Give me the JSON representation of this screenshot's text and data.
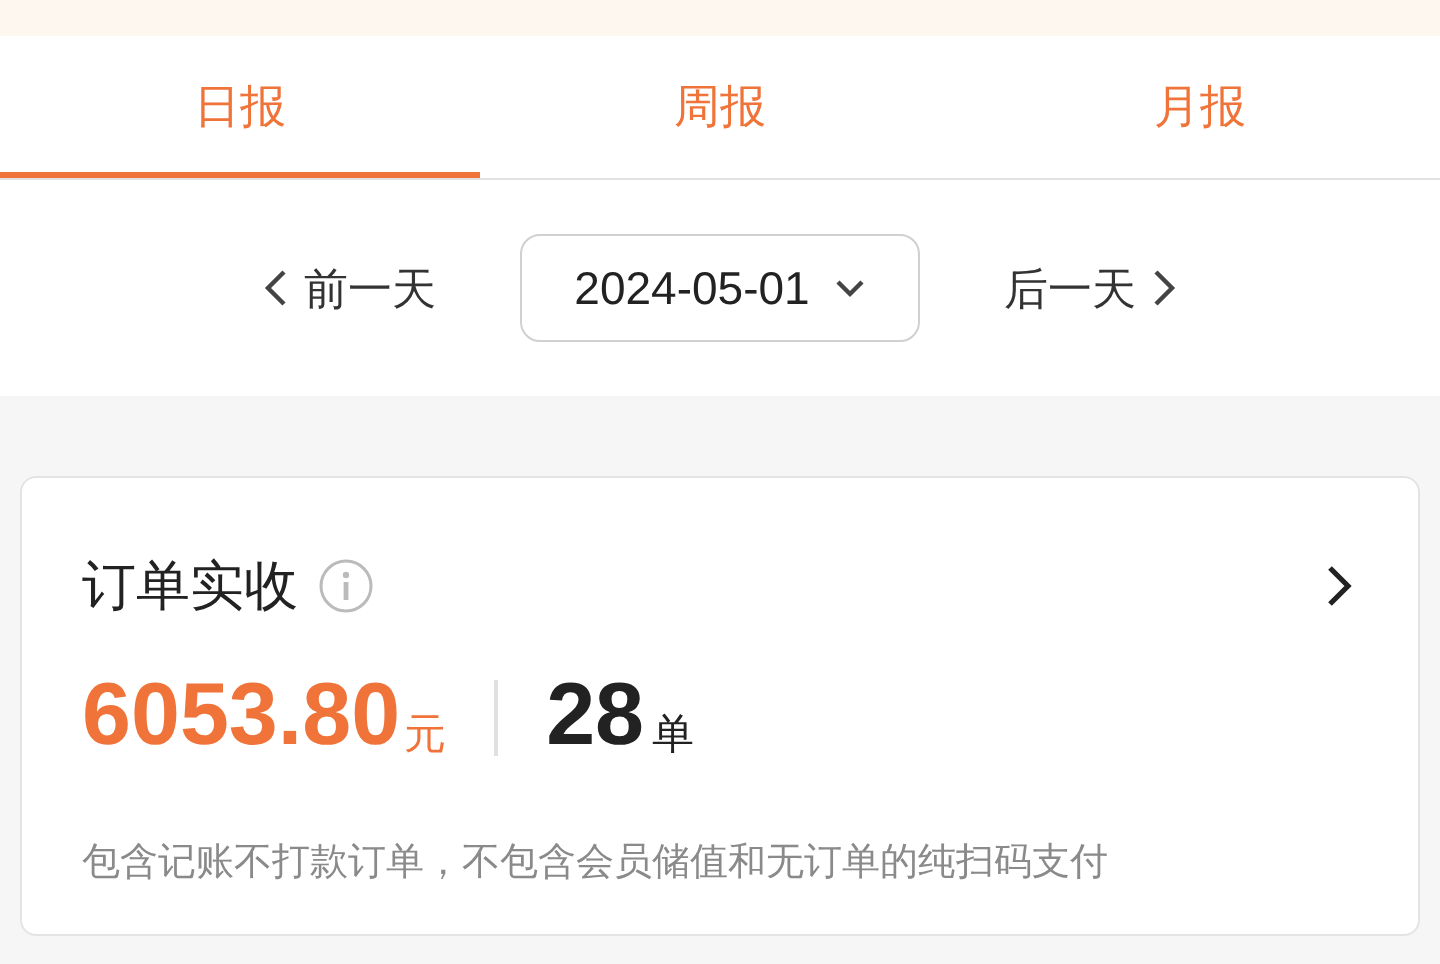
{
  "tabs": [
    {
      "label": "日报",
      "selected": true
    },
    {
      "label": "周报",
      "selected": false
    },
    {
      "label": "月报",
      "selected": false
    }
  ],
  "date_nav": {
    "prev": "前一天",
    "date": "2024-05-01",
    "next": "后一天"
  },
  "card": {
    "title": "订单实收",
    "amount": "6053.80",
    "amount_unit": "元",
    "count": "28",
    "count_unit": "单",
    "note": "包含记账不打款订单，不包含会员储值和无订单的纯扫码支付"
  }
}
